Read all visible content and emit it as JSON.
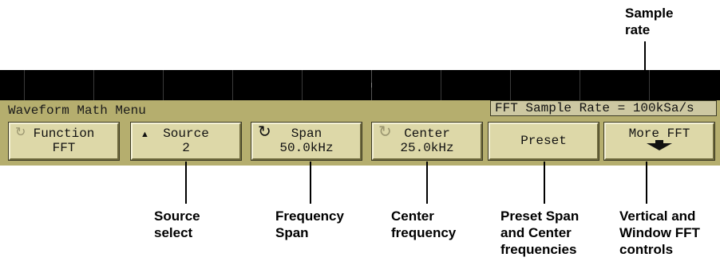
{
  "callouts": {
    "sample_rate": [
      "Sample",
      "rate"
    ],
    "source_select": [
      "Source",
      "select"
    ],
    "frequency_span": [
      "Frequency",
      "Span"
    ],
    "center_frequency": [
      "Center",
      "frequency"
    ],
    "preset": [
      "Preset Span",
      "and Center",
      "frequencies"
    ],
    "more_fft": [
      "Vertical and",
      "Window FFT",
      "controls"
    ]
  },
  "menu": {
    "title": "Waveform Math Menu",
    "sample_rate_status": "FFT Sample Rate = 100kSa/s"
  },
  "softkeys": {
    "function": {
      "label": "Function",
      "value": "FFT",
      "icon": "knob-rotate-icon"
    },
    "source": {
      "label": "Source",
      "value": "2",
      "icon": "up-triangle-icon"
    },
    "span": {
      "label": "Span",
      "value": "50.0kHz",
      "icon": "knob-rotate-icon"
    },
    "center": {
      "label": "Center",
      "value": "25.0kHz",
      "icon": "knob-rotate-icon"
    },
    "preset": {
      "label": "Preset"
    },
    "more_fft": {
      "label": "More FFT",
      "icon": "down-arrow-icon"
    }
  },
  "colors": {
    "menu_bar": "#b5ae6e",
    "softkey": "#ddd8a8",
    "screen": "#000000"
  }
}
